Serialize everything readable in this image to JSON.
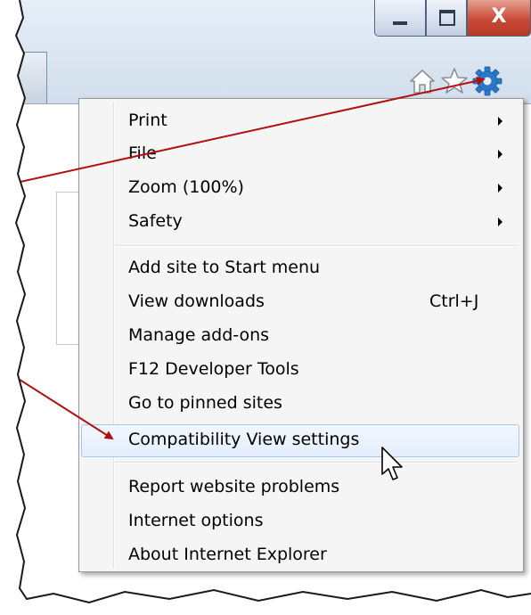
{
  "window": {
    "buttons": {
      "minimize": "",
      "maximize": "",
      "close": "X"
    }
  },
  "toolbar": {
    "icons": [
      "home-icon",
      "favorites-star-icon",
      "tools-gear-icon"
    ]
  },
  "menu": {
    "items": [
      {
        "label": "Print",
        "shortcut": "",
        "submenu": true
      },
      {
        "label": "File",
        "shortcut": "",
        "submenu": true
      },
      {
        "label": "Zoom (100%)",
        "shortcut": "",
        "submenu": true
      },
      {
        "label": "Safety",
        "shortcut": "",
        "submenu": true
      },
      {
        "label": "Add site to Start menu",
        "shortcut": "",
        "submenu": false
      },
      {
        "label": "View downloads",
        "shortcut": "Ctrl+J",
        "submenu": false
      },
      {
        "label": "Manage add-ons",
        "shortcut": "",
        "submenu": false
      },
      {
        "label": "F12 Developer Tools",
        "shortcut": "",
        "submenu": false
      },
      {
        "label": "Go to pinned sites",
        "shortcut": "",
        "submenu": false
      },
      {
        "label": "Compatibility View settings",
        "shortcut": "",
        "submenu": false,
        "highlighted": true
      },
      {
        "label": "Report website problems",
        "shortcut": "",
        "submenu": false
      },
      {
        "label": "Internet options",
        "shortcut": "",
        "submenu": false
      },
      {
        "label": "About Internet Explorer",
        "shortcut": "",
        "submenu": false
      }
    ]
  },
  "colors": {
    "arrow": "#b01010",
    "gear": "#2a78c8",
    "close_button": "#c94a36",
    "highlight_border": "#a8c8ec"
  }
}
